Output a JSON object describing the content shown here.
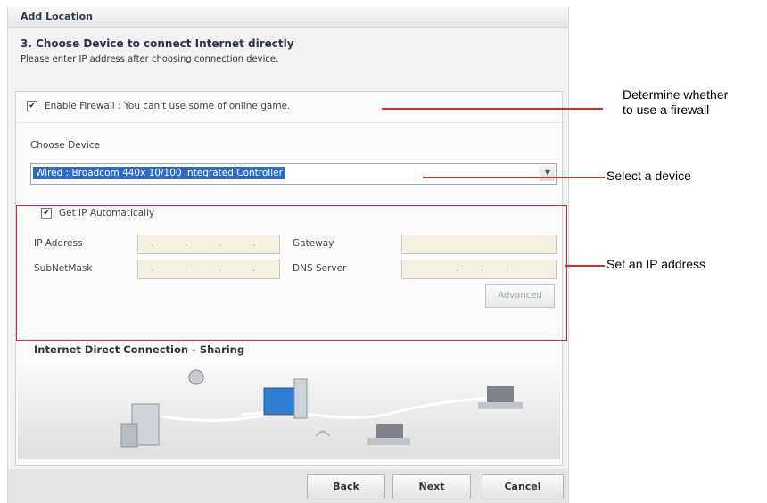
{
  "dialog": {
    "title": "Add Location",
    "step_title": "3. Choose Device to connect Internet directly",
    "step_desc": "Please enter IP address after choosing connection device."
  },
  "firewall": {
    "checked": true,
    "label": "Enable Firewall : You can't use some of online game."
  },
  "device": {
    "label": "Choose Device",
    "selected": "Wired : Broadcom 440x 10/100 Integrated Controller"
  },
  "ip": {
    "auto_checked": true,
    "auto_label": "Get IP Automatically",
    "ip_label": "IP Address",
    "mask_label": "SubNetMask",
    "gateway_label": "Gateway",
    "dns_label": "DNS Server",
    "advanced_label": "Advanced"
  },
  "illustration": {
    "title": "Internet Direct Connection - Sharing"
  },
  "buttons": {
    "back": "Back",
    "next": "Next",
    "cancel": "Cancel"
  },
  "callouts": {
    "firewall_line1": "Determine whether",
    "firewall_line2": "to use a firewall",
    "device": "Select a device",
    "ip": "Set an IP address"
  },
  "colors": {
    "callout": "#e0282e",
    "selection": "#3169c6"
  }
}
